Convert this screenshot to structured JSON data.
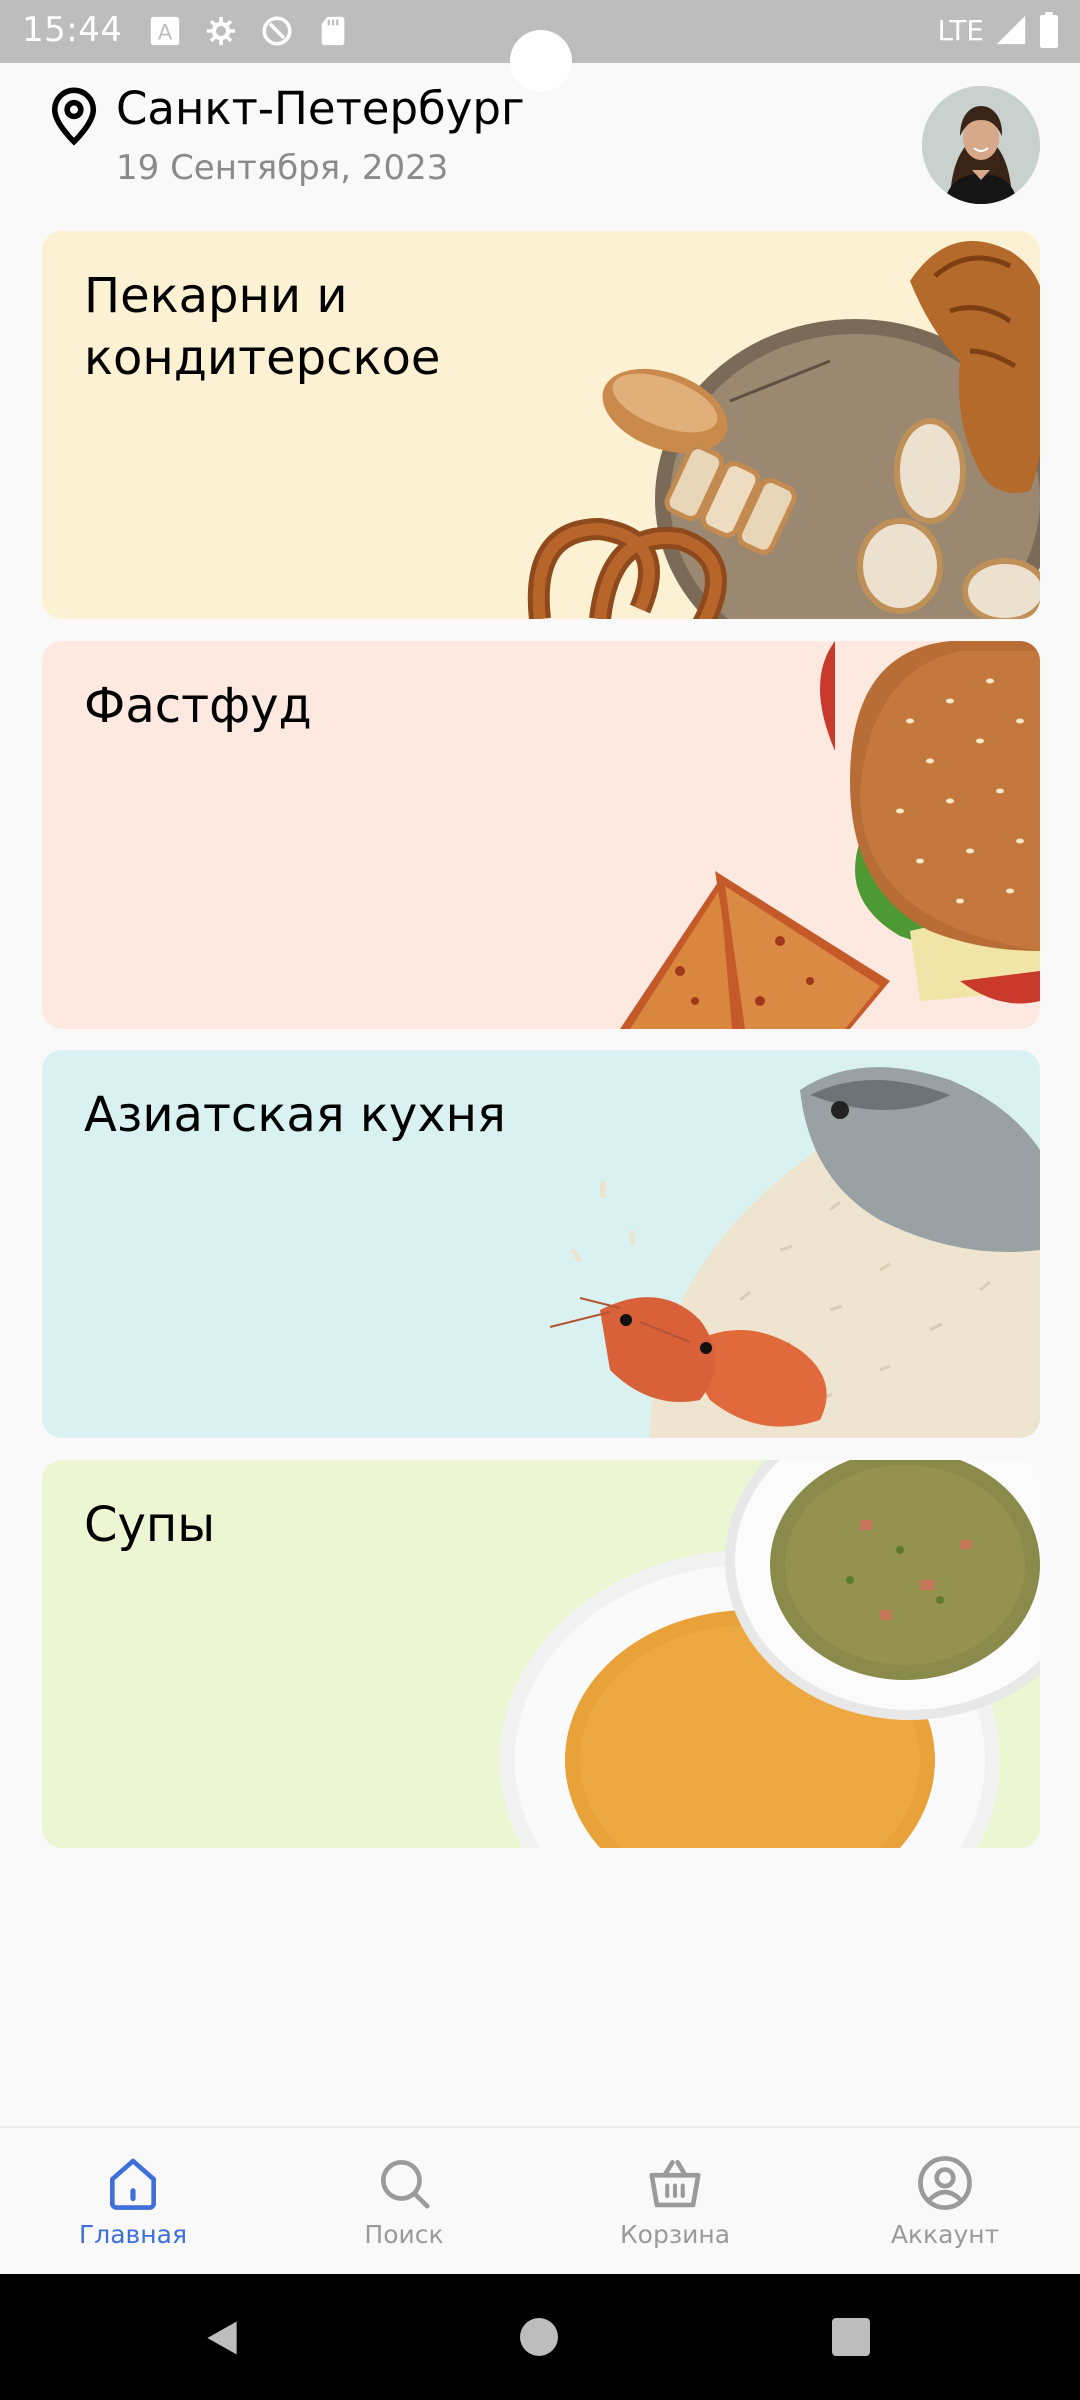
{
  "status_bar": {
    "time": "15:44",
    "network": "LTE",
    "icons": [
      "font-a-icon",
      "settings-sync-icon",
      "rotation-icon",
      "sd-card-icon",
      "signal-icon",
      "battery-icon"
    ]
  },
  "header": {
    "city": "Санкт-Петербург",
    "date": "19 Сентября, 2023"
  },
  "categories": [
    {
      "title_line1": "Пекарни и",
      "title_line2": "кондитерское",
      "bg": "#fdf1d3",
      "image": "bakery-image"
    },
    {
      "title_line1": "Фастфуд",
      "bg": "#fde9e0",
      "image": "fastfood-image"
    },
    {
      "title_line1": "Азиатская кухня",
      "bg": "#d9f2f1",
      "image": "asian-food-image"
    },
    {
      "title_line1": "Супы",
      "bg": "#eef5d3",
      "image": "soups-image"
    }
  ],
  "bottom_nav": {
    "items": [
      {
        "label": "Главная",
        "icon": "home-icon",
        "active": true
      },
      {
        "label": "Поиск",
        "icon": "search-icon",
        "active": false
      },
      {
        "label": "Корзина",
        "icon": "basket-icon",
        "active": false
      },
      {
        "label": "Аккаунт",
        "icon": "account-icon",
        "active": false
      }
    ],
    "active_color": "#3f6fd8",
    "inactive_color": "#9a9a9a"
  }
}
